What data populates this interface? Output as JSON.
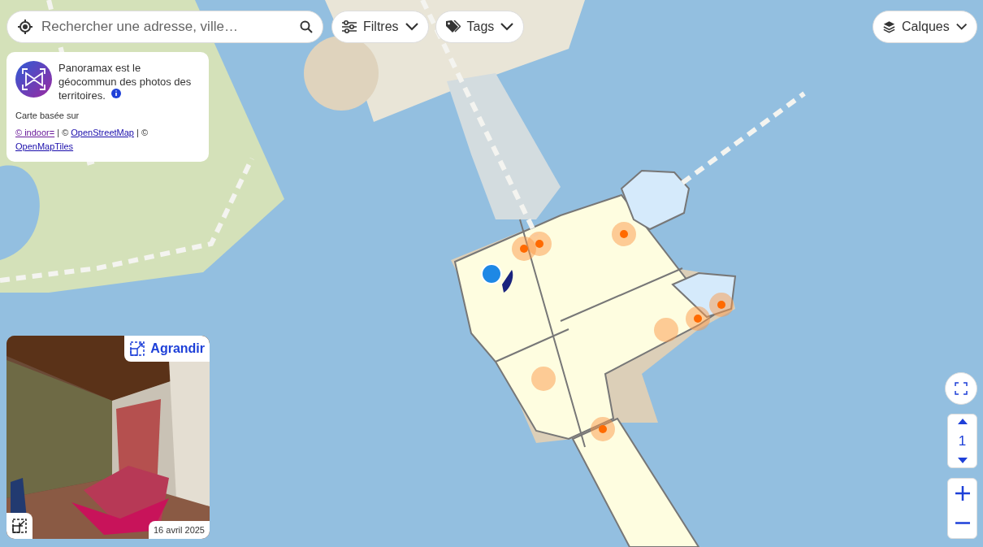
{
  "search": {
    "placeholder": "Rechercher une adresse, ville…"
  },
  "filter_buttons": [
    {
      "kind": "filters",
      "label": "Filtres"
    },
    {
      "kind": "tags",
      "label": "Tags"
    }
  ],
  "layers_button": {
    "label": "Calques"
  },
  "info_card": {
    "text": "Panoramax est le géocommun des photos des territoires.",
    "attribution_title": "Carte basée sur",
    "attribution": [
      {
        "kind": "link",
        "text": "© indoor=",
        "visited": true
      },
      {
        "kind": "text",
        "text": " | © "
      },
      {
        "kind": "link",
        "text": "OpenStreetMap",
        "visited": false
      },
      {
        "kind": "text",
        "text": " | © "
      },
      {
        "kind": "link",
        "text": "OpenMapTiles",
        "visited": false
      }
    ]
  },
  "photo_preview": {
    "expand_label": "Agrandir",
    "date": "16 avril 2025"
  },
  "level_selector": {
    "value": "1"
  }
}
